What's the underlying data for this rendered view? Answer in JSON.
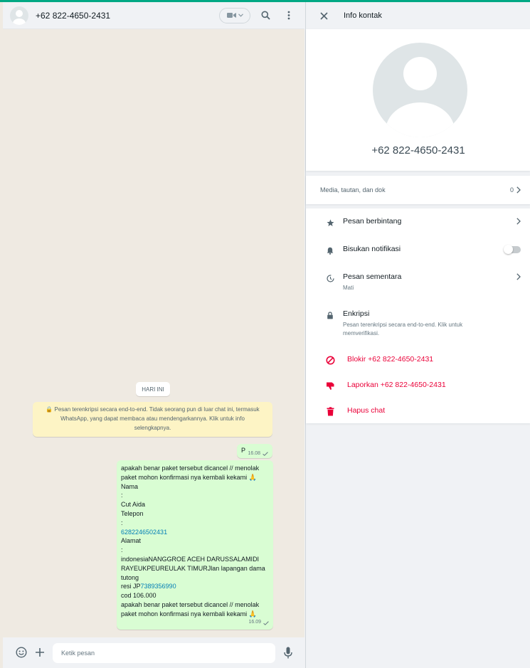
{
  "chat": {
    "header_title": "+62 822-4650-2431",
    "date_chip": "HARI INI",
    "encryption_notice": "🔒 Pesan terenkripsi secara end-to-end. Tidak seorang pun di luar chat ini, termasuk WhatsApp, yang dapat membaca atau mendengarkannya. Klik untuk info selengkapnya.",
    "messages": [
      {
        "text": "P",
        "time": "16.08"
      },
      {
        "lines": [
          "apakah benar paket tersebut  dicancel // menolak",
          "paket mohon konfirmasi nya kembali kekami 🙏",
          "Nama",
          ":",
          "Cut Aida",
          "Telepon",
          ":",
          "6282246502431",
          "Alamat",
          ":",
          "indonesiaNANGGROE ACEH DARUSSALAMIDI",
          "RAYEUKPEUREULAK TIMURJlan lapangan dama",
          "tutong",
          "resi JP",
          "7389356990",
          "cod 106.000",
          "apakah benar paket tersebut  dicancel // menolak",
          "paket mohon konfirmasi nya kembali kekami 🙏"
        ],
        "time": "16.09"
      }
    ],
    "composer_placeholder": "Ketik pesan"
  },
  "info": {
    "title": "Info kontak",
    "phone": "+62 822-4650-2431",
    "media_label": "Media, tautan, dan dok",
    "media_count": "0",
    "options": {
      "starred": "Pesan berbintang",
      "mute": "Bisukan notifikasi",
      "disappearing": "Pesan sementara",
      "disappearing_sub": "Mati",
      "encryption": "Enkripsi",
      "encryption_sub": "Pesan terenkripsi secara end-to-end. Klik untuk memverifikasi.",
      "block": "Blokir +62 822-4650-2431",
      "report": "Laporkan +62 822-4650-2431",
      "delete": "Hapus chat"
    }
  },
  "colors": {
    "accent": "#00a884",
    "outgoing_bubble": "#d9fdd3",
    "danger": "#ea0038",
    "link": "#027eb5"
  },
  "icons": {
    "close": "close-icon",
    "search": "search-icon",
    "menu": "menu-icon",
    "video": "video-call-icon",
    "emoji": "emoji-icon",
    "attach": "plus-icon",
    "mic": "mic-icon",
    "star": "star-icon",
    "bell": "bell-icon",
    "timer": "timer-icon",
    "lock": "lock-icon",
    "block": "block-icon",
    "thumb_down": "thumb-down-icon",
    "trash": "trash-icon"
  }
}
